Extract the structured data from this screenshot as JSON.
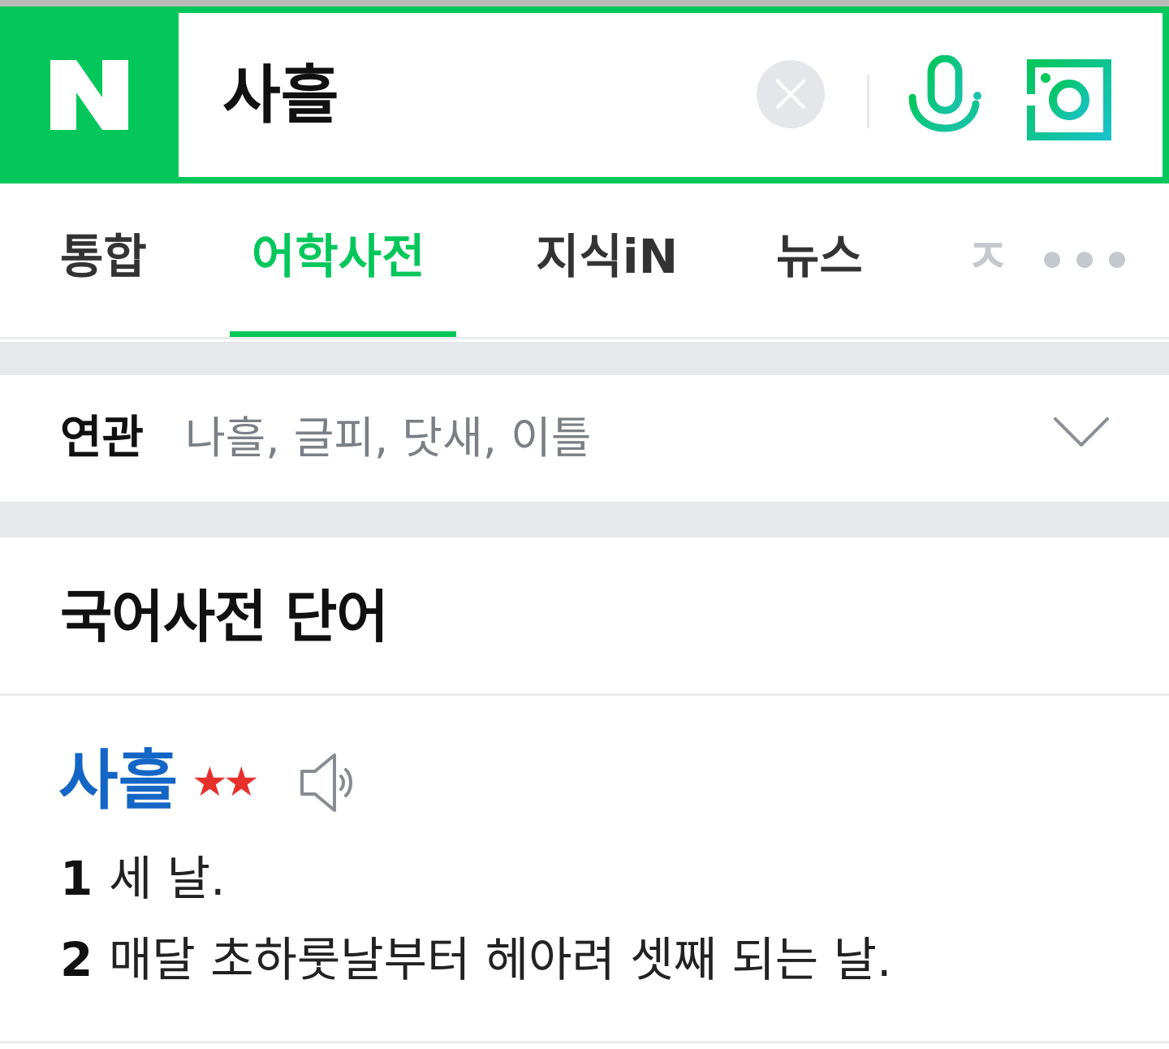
{
  "header": {
    "logo_letter": "N",
    "search_query": "사흘"
  },
  "tabs": [
    {
      "label": "통합",
      "active": false
    },
    {
      "label": "어학사전",
      "active": true
    },
    {
      "label": "지식iN",
      "active": false
    },
    {
      "label": "뉴스",
      "active": false
    },
    {
      "label": "ㅈ",
      "active": false
    }
  ],
  "related": {
    "label": "연관",
    "words": "나흘, 글피, 닷새, 이틀"
  },
  "section": {
    "title": "국어사전 단어"
  },
  "entry": {
    "word": "사흘",
    "stars": "★★",
    "definitions": [
      {
        "num": "1",
        "text": "세 날."
      },
      {
        "num": "2",
        "text": "매달 초하룻날부터 헤아려 셋째 되는 날."
      }
    ]
  },
  "colors": {
    "brand_green": "#03c75a",
    "link_blue": "#1466c5",
    "star_red": "#e8302b"
  }
}
